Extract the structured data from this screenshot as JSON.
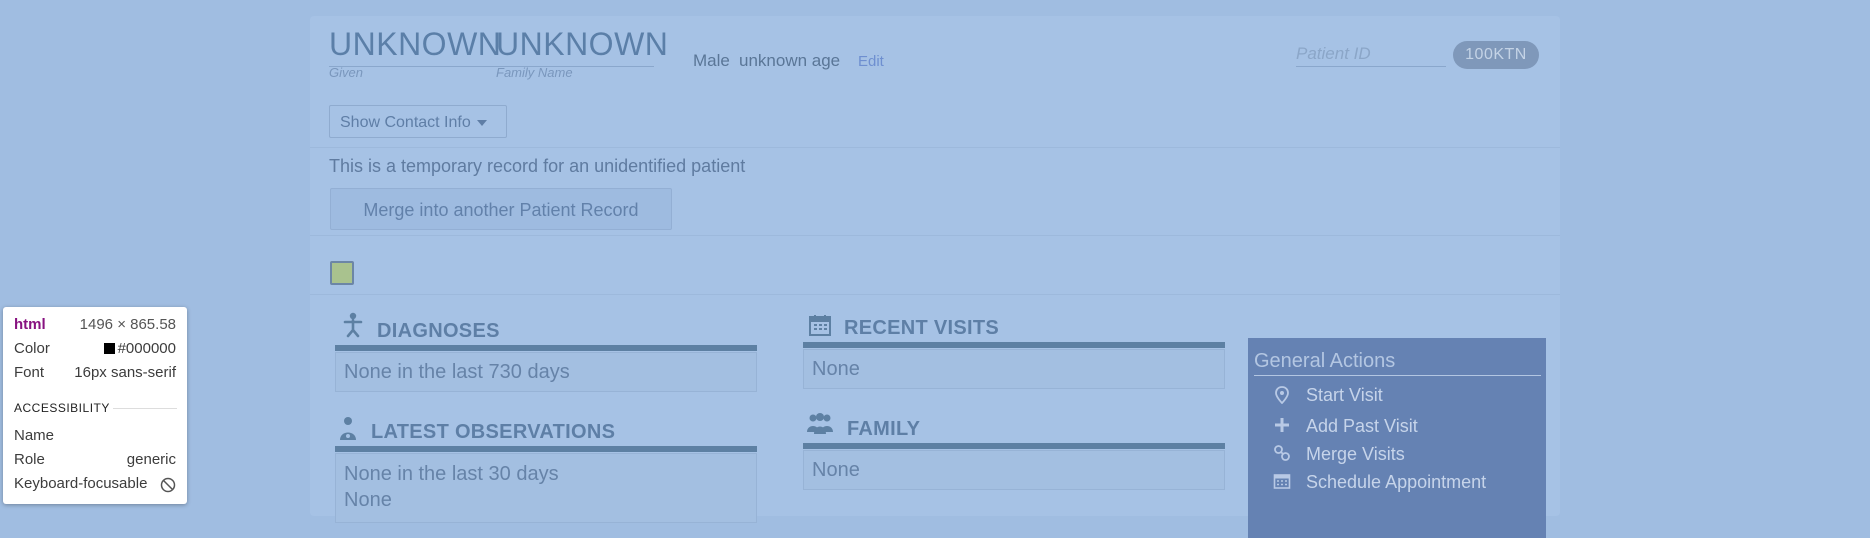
{
  "patient": {
    "given_name": "UNKNOWN",
    "family_name": "UNKNOWN",
    "given_label": "Given",
    "family_label": "Family Name",
    "gender": "Male",
    "age": "unknown age",
    "edit_label": "Edit",
    "patient_id_label": "Patient ID",
    "patient_id_value": "100KTN",
    "contact_button": "Show Contact Info"
  },
  "temp_record": {
    "message": "This is a temporary record for an unidentified patient",
    "merge_button": "Merge into another Patient Record"
  },
  "sections": {
    "diagnoses": {
      "title": "DIAGNOSES",
      "body": "None in the last 730 days",
      "icon": "diagnosis-icon"
    },
    "observations": {
      "title": "LATEST OBSERVATIONS",
      "body": "None in the last 30 days",
      "extra": "None",
      "icon": "doctor-icon"
    },
    "recent_visits": {
      "title": "RECENT VISITS",
      "body": "None",
      "icon": "calendar-icon"
    },
    "family": {
      "title": "FAMILY",
      "body": "None",
      "icon": "people-icon"
    }
  },
  "general_actions": {
    "title": "General Actions",
    "items": [
      {
        "label": "Start Visit",
        "icon": "location-pin-icon"
      },
      {
        "label": "Add Past Visit",
        "icon": "plus-icon"
      },
      {
        "label": "Merge Visits",
        "icon": "link-icon"
      },
      {
        "label": "Schedule Appointment",
        "icon": "calendar-icon"
      }
    ]
  },
  "inspector": {
    "tag": "html",
    "size": "1496 × 865.58",
    "color_label": "Color",
    "color_value": "#000000",
    "font_label": "Font",
    "font_value": "16px sans-serif",
    "accessibility_heading": "ACCESSIBILITY",
    "name_label": "Name",
    "role_label": "Role",
    "role_value": "generic",
    "focusable_label": "Keyboard-focusable"
  },
  "colors": {
    "page_bg": "#a0bde1",
    "accent_dark": "#5d80a3",
    "actions_bg": "#6582b3"
  }
}
